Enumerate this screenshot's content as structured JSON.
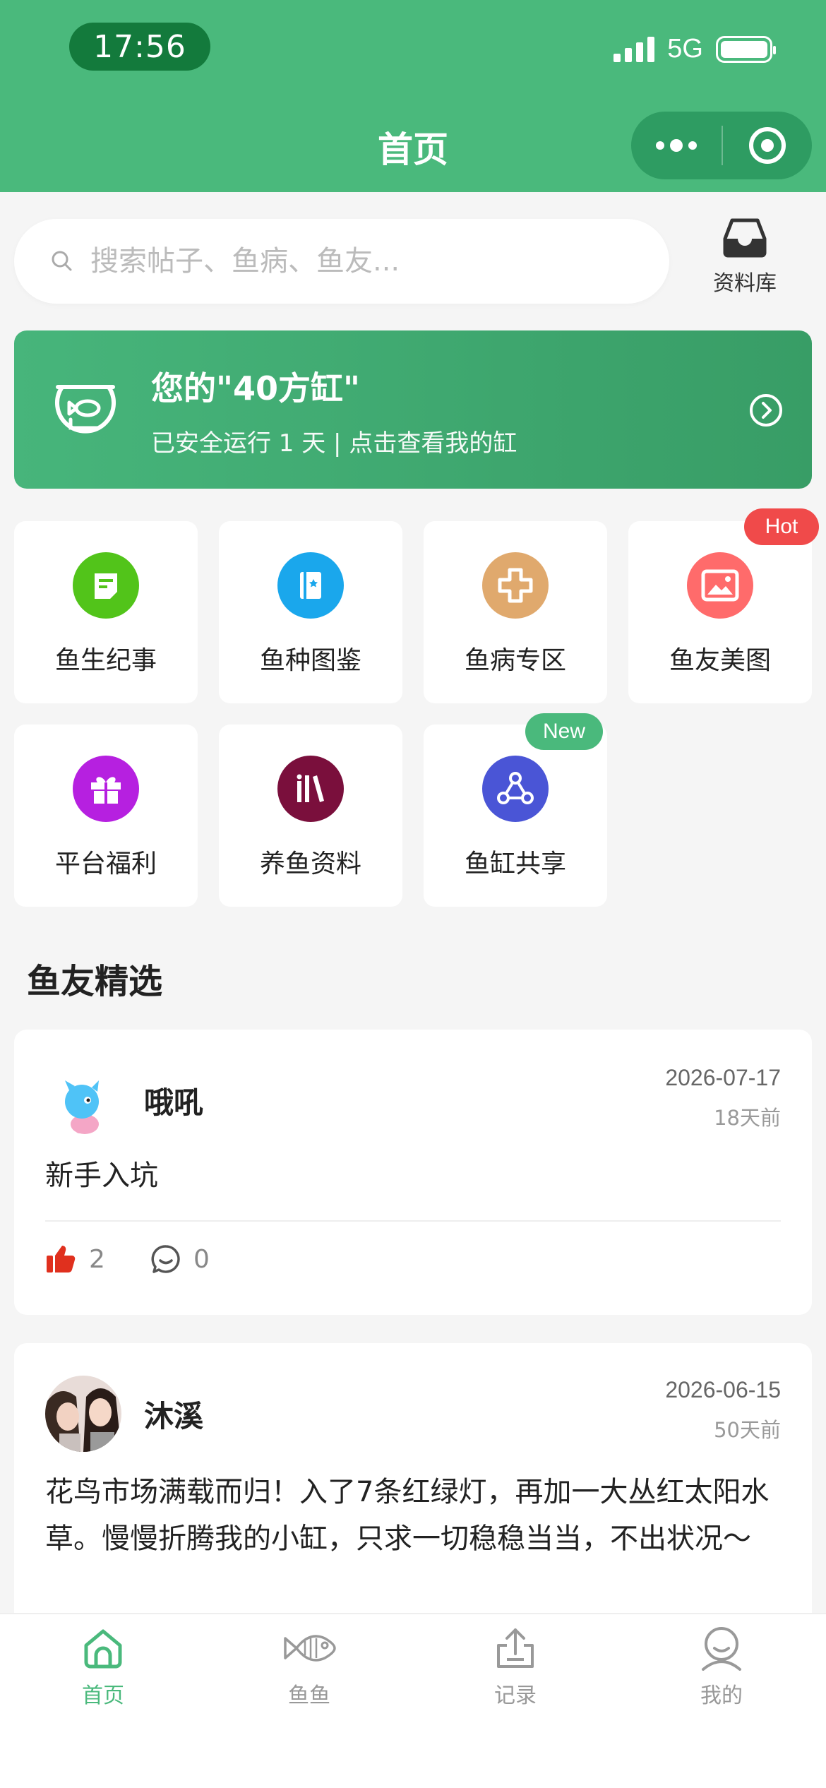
{
  "status_bar": {
    "time": "17:56",
    "network": "5G"
  },
  "header": {
    "title": "首页"
  },
  "search": {
    "placeholder": "搜索帖子、鱼病、鱼友..."
  },
  "library": {
    "label": "资料库"
  },
  "tank_banner": {
    "title": "您的\"40方缸\"",
    "subtitle": "已安全运行 1 天 | 点击查看我的缸"
  },
  "grid": {
    "items": [
      {
        "label": "鱼生纪事",
        "icon": "note-icon",
        "color": "#52c41a"
      },
      {
        "label": "鱼种图鉴",
        "icon": "book-icon",
        "color": "#1aa7ec"
      },
      {
        "label": "鱼病专区",
        "icon": "medical-cross-icon",
        "color": "#e0a96d"
      },
      {
        "label": "鱼友美图",
        "icon": "picture-icon",
        "color": "#ff6b6b",
        "badge": "Hot"
      },
      {
        "label": "平台福利",
        "icon": "gift-icon",
        "color": "#b620e0"
      },
      {
        "label": "养鱼资料",
        "icon": "library-books-icon",
        "color": "#7a0f3c"
      },
      {
        "label": "鱼缸共享",
        "icon": "share-nodes-icon",
        "color": "#4a55d6",
        "badge": "New"
      }
    ]
  },
  "section": {
    "title": "鱼友精选"
  },
  "posts": [
    {
      "author": "哦吼",
      "date": "2026-07-17",
      "ago": "18天前",
      "content": "新手入坑",
      "likes": "2",
      "comments": "0"
    },
    {
      "author": "沐溪",
      "date": "2026-06-15",
      "ago": "50天前",
      "content": "花鸟市场满载而归！入了7条红绿灯，再加一大丛红太阳水草。慢慢折腾我的小缸，只求一切稳稳当当，不出状况～"
    }
  ],
  "tabbar": {
    "items": [
      {
        "label": "首页",
        "icon": "home-icon",
        "active": true
      },
      {
        "label": "鱼鱼",
        "icon": "fish-icon"
      },
      {
        "label": "记录",
        "icon": "upload-icon"
      },
      {
        "label": "我的",
        "icon": "user-icon"
      }
    ]
  },
  "colors": {
    "primary": "#4ab97c",
    "dark_green": "#137a3c",
    "hot_badge": "#f04a4a",
    "new_badge": "#4ab97c"
  }
}
